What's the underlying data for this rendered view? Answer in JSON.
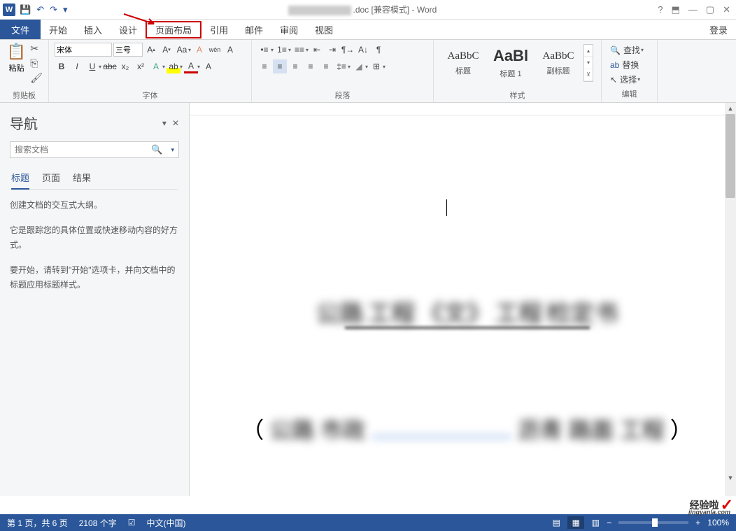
{
  "titlebar": {
    "suffix": ".doc [兼容模式] - Word",
    "help": "?",
    "restore": "▢",
    "minimize": "—",
    "close": "✕"
  },
  "menu": {
    "file": "文件",
    "home": "开始",
    "insert": "插入",
    "design": "设计",
    "layout": "页面布局",
    "references": "引用",
    "mailings": "邮件",
    "review": "审阅",
    "view": "视图",
    "login": "登录"
  },
  "ribbon": {
    "clipboard": {
      "paste": "粘贴",
      "label": "剪贴板"
    },
    "font": {
      "name": "宋体",
      "size": "三号",
      "label": "字体",
      "bold": "B",
      "italic": "I",
      "underline": "U"
    },
    "paragraph": {
      "label": "段落"
    },
    "styles": {
      "label": "样式",
      "items": [
        {
          "preview": "AaBbC",
          "cls": "",
          "name": "标题"
        },
        {
          "preview": "AaBl",
          "cls": "big",
          "name": "标题 1"
        },
        {
          "preview": "AaBbC",
          "cls": "",
          "name": "副标题"
        }
      ]
    },
    "editing": {
      "label": "编辑",
      "find": "查找",
      "replace": "替换",
      "select": "选择"
    }
  },
  "nav": {
    "title": "导航",
    "search_placeholder": "搜索文档",
    "tabs": {
      "headings": "标题",
      "pages": "页面",
      "results": "结果"
    },
    "p1": "创建文档的交互式大纲。",
    "p2": "它是跟踪您的具体位置或快速移动内容的好方式。",
    "p3": "要开始，请转到\"开始\"选项卡，并向文档中的标题应用标题样式。"
  },
  "status": {
    "page": "第 1 页，共 6 页",
    "words": "2108 个字",
    "lang": "中文(中国)",
    "zoom": "100%"
  },
  "watermark": {
    "main": "经验啦",
    "sub": "jingyanla.com"
  }
}
